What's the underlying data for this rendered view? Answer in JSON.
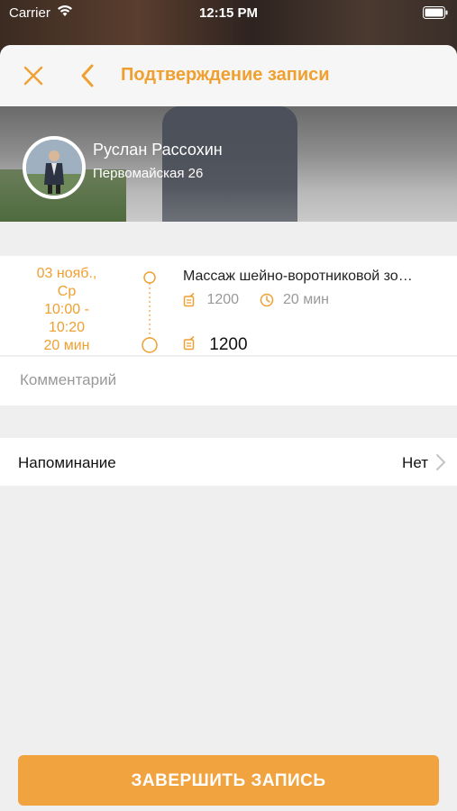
{
  "status_bar": {
    "carrier": "Carrier",
    "time": "12:15 PM"
  },
  "header": {
    "title": "Подтверждение записи"
  },
  "specialist": {
    "name": "Руслан Рассохин",
    "address": "Первомайская 26"
  },
  "booking": {
    "date": "03 нояб.,",
    "weekday": "Ср",
    "time_range_start": "10:00 -",
    "time_range_end": "10:20",
    "duration": "20 мин",
    "service_name": "Массаж шейно-воротниковой зо…",
    "price": "1200",
    "service_duration": "20 мин",
    "total": "1200"
  },
  "comment": {
    "placeholder": "Комментарий",
    "value": ""
  },
  "reminder": {
    "label": "Напоминание",
    "value": "Нет"
  },
  "submit": {
    "label": "ЗАВЕРШИТЬ ЗАПИСЬ"
  },
  "colors": {
    "accent": "#f0a030",
    "button": "#f0a33f",
    "background": "#efefef"
  }
}
